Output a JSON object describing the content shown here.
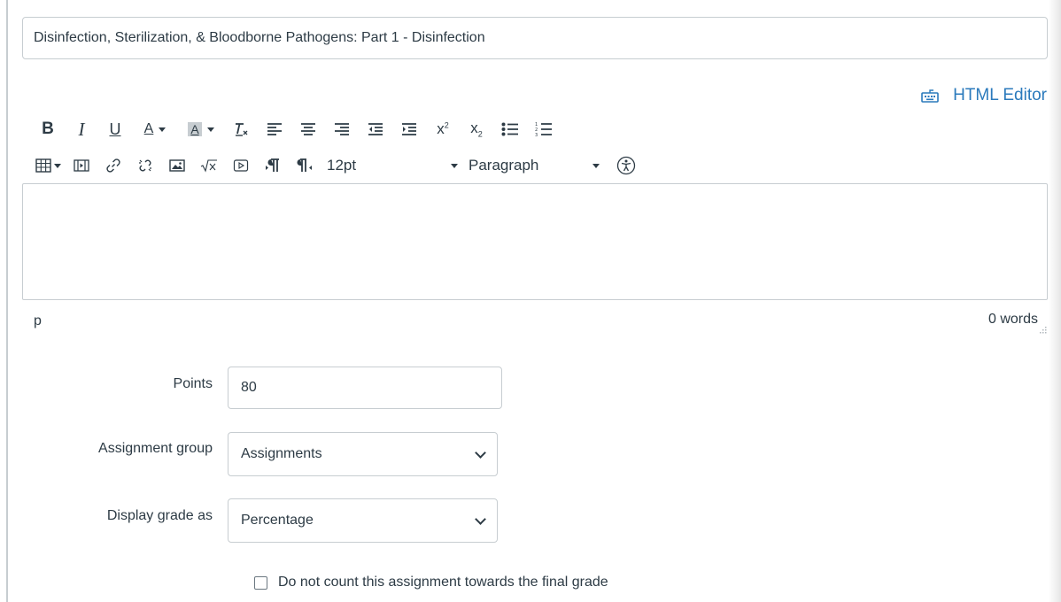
{
  "assignment": {
    "title": "Disinfection, Sterilization, & Bloodborne Pathogens: Part 1 - Disinfection"
  },
  "editor": {
    "html_editor_label": "HTML Editor",
    "toolbar_row1": [
      {
        "name": "bold-button",
        "glyph": "B"
      },
      {
        "name": "italic-button",
        "glyph": "I"
      },
      {
        "name": "underline-button",
        "glyph": "U"
      },
      {
        "name": "font-color-button",
        "glyph": "A"
      },
      {
        "name": "background-color-button",
        "glyph": "A"
      },
      {
        "name": "clear-formatting-button",
        "glyph": "Tx"
      },
      {
        "name": "align-left-button",
        "glyph": "≡"
      },
      {
        "name": "align-center-button",
        "glyph": "≡"
      },
      {
        "name": "align-right-button",
        "glyph": "≡"
      },
      {
        "name": "outdent-button",
        "glyph": "⇤"
      },
      {
        "name": "indent-button",
        "glyph": "⇥"
      },
      {
        "name": "superscript-button",
        "glyph": "x²"
      },
      {
        "name": "subscript-button",
        "glyph": "x₂"
      },
      {
        "name": "bullet-list-button",
        "glyph": "•≡"
      },
      {
        "name": "numbered-list-button",
        "glyph": "1≡"
      }
    ],
    "font_size": "12pt",
    "block_format": "Paragraph",
    "status_path": "p",
    "word_count": "0 words"
  },
  "form": {
    "points_label": "Points",
    "points_value": "80",
    "assignment_group_label": "Assignment group",
    "assignment_group_value": "Assignments",
    "display_grade_label": "Display grade as",
    "display_grade_value": "Percentage",
    "exclude_checkbox_label": "Do not count this assignment towards the final grade",
    "exclude_checkbox_checked": false
  },
  "colors": {
    "link": "#2b7abc",
    "text": "#2d3b45",
    "border": "#c7cdd1"
  }
}
